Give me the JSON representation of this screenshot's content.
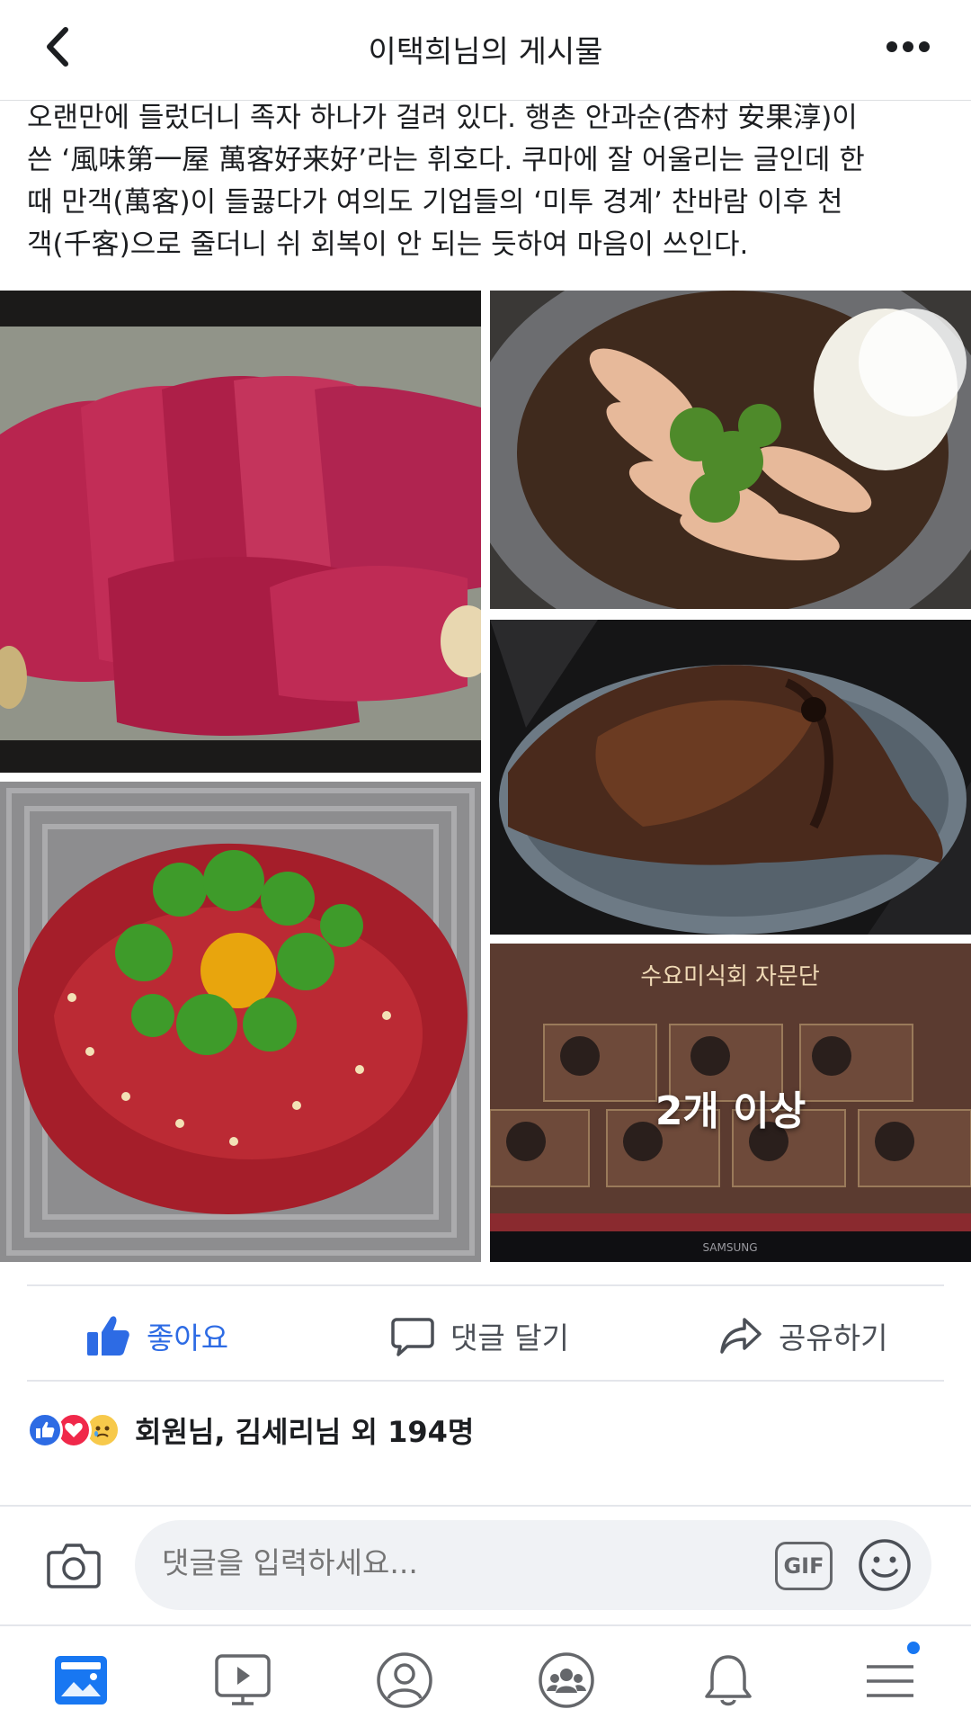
{
  "header": {
    "title": "이택희님의 게시물",
    "back_icon": "chevron-left-icon",
    "more_icon": "more-horizontal-icon"
  },
  "post": {
    "text_lines": [
      " 오랜만에 들렀더니 족자 하나가 걸려 있다. 행촌 안과순(杏村 安果淳)이",
      "쓴 ‘風味第一屋 萬客好来好’라는 휘호다. 쿠마에 잘 어울리는 글인데 한",
      "때 만객(萬客)이 들끓다가 여의도 기업들의 ‘미투 경계’ 찬바람 이후 천",
      "객(千客)으로 줄더니 쉬 회복이 안 되는 듯하여 마음이 쓰인다."
    ]
  },
  "photos": {
    "more_label": "2개 이상",
    "tv_title": "수요미식회 자문단",
    "tv_brand": "SAMSUNG"
  },
  "actions": {
    "like": "좋아요",
    "comment": "댓글 달기",
    "share": "공유하기",
    "like_color": "#2d6be4"
  },
  "reactions": {
    "summary": "회원님, 김세리님 외 194명",
    "icons": [
      "like-reaction-icon",
      "love-reaction-icon",
      "sad-reaction-icon"
    ]
  },
  "composer": {
    "placeholder": "댓글을 입력하세요...",
    "gif_label": "GIF"
  },
  "bottom_nav": {
    "items": [
      "news-feed-icon",
      "watch-icon",
      "profile-icon",
      "groups-icon",
      "notifications-icon",
      "menu-icon"
    ],
    "accent": "#1877f2"
  }
}
